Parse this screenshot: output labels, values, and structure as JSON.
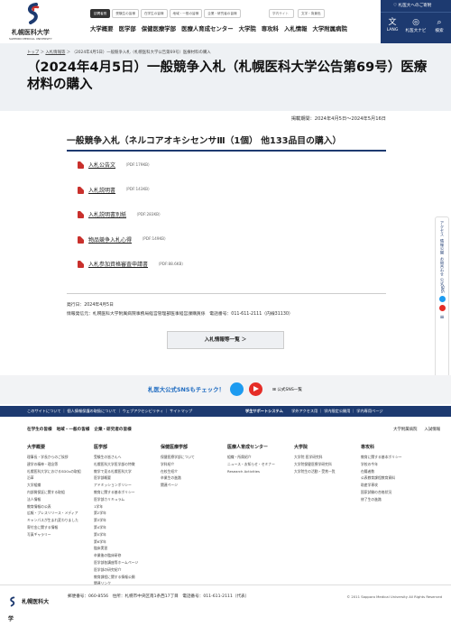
{
  "header": {
    "logo_text": "札幌医科大学",
    "logo_subtext": "SAPPORO MEDICAL UNIVERSITY",
    "top_links": [
      "訪問者別",
      "受験生の皆様",
      "在学生の皆様",
      "地域・一般の皆様",
      "企業・研究者の皆様"
    ],
    "search_label": "学内サイト",
    "language_label": "文字・背景色",
    "main_nav": [
      "大学概要",
      "医学部",
      "保健医療学部",
      "医療人育成センター",
      "大学院",
      "専攻科",
      "入札情報",
      "大学附属病院"
    ],
    "right_top": "札医大へのご寄附",
    "right_buttons": [
      {
        "label": "LANG",
        "icon": "translate-icon"
      },
      {
        "label": "札医大ナビ",
        "icon": "compass-icon"
      },
      {
        "label": "検索",
        "icon": "search-icon"
      }
    ]
  },
  "breadcrumb": {
    "home": "トップ",
    "section": "入札情報等",
    "current": "（2024年4月5日）一般競争入札（札幌医科大学公告第69号）医療材料の購入"
  },
  "page_title": "（2024年4月5日）一般競争入札（札幌医科大学公告第69号）医療材料の購入",
  "period": "掲載期間：2024年4月5日～2024年5月16日",
  "section_heading": "一般競争入札（ネルコアオキシセンサⅢ（1個） 他133品目の購入）",
  "files": [
    {
      "label": "入札公告文",
      "size": "（PDF:179KB）"
    },
    {
      "label": "入札説明書",
      "size": "（PDF:143KB）"
    },
    {
      "label": "入札説明書別紙",
      "size": "（PDF:283KB）"
    },
    {
      "label": "物品競争入札心得",
      "size": "（PDF:149KB）"
    },
    {
      "label": "入札参加資格審査申請書",
      "size": "（PDF:88.6KB）"
    }
  ],
  "meta": {
    "date": "発行日：2024年4月5日",
    "sender": "情報発信元：札幌医科大学附属病院事務局経営管理部医事経営課購買係　電話番号：011-611-2111（内線31130）"
  },
  "list_button": "入札情報等一覧",
  "side_tabs": [
    "アクセス",
    "情報公開",
    "お問合わせ",
    "公式SNS"
  ],
  "sns": {
    "title": "札医大公式SNSもチェック！",
    "all_link": "公式SNS一覧"
  },
  "footer_bar": {
    "left": "このサイトについて ｜ 個人情報保護の取扱について ｜ ウェブアクセシビリティ ｜ サイトマップ",
    "right": [
      "学生サポートシステム",
      "学外アクセス用",
      "学内限定公開用",
      "学内専用ページ"
    ]
  },
  "footer_cats": [
    "在学生の皆様",
    "地域・一般の皆様",
    "企業・研究者の皆様"
  ],
  "footer_cats_right": [
    "大学附属病院",
    "入試情報"
  ],
  "footer_columns": [
    {
      "heading": "大学概要",
      "items": [
        "理事長・学長からのご挨拶",
        "建学の精神・理念等",
        "札幌医科大学におけるSDGsの取組",
        "沿革",
        "大学組織",
        "内部質保証に関する取組",
        "法人情報",
        "教育情報の公表",
        "広報・プレスリリース・メディア",
        "キャンパスが生まれ変わりました",
        "寄付金に関する情報",
        "写真ギャラリー"
      ]
    },
    {
      "heading": "医学部",
      "items": [
        "受験生の皆さんへ",
        "札幌医科大学医学部の特徴",
        "教学で見る札幌医科大学",
        "医学部概要",
        "アドミッションポリシー",
        "教育に関する基本ポリシー",
        "医学部カリキュラム",
        "1学年",
        "第2学年",
        "第3学年",
        "第4学年",
        "第5学年",
        "第6学年",
        "臨床実習",
        "卒業後の臨床研修",
        "医学部各講座等ホームページ",
        "医学部の研究紹介",
        "教育課程に関する情報公開",
        "関連リンク"
      ]
    },
    {
      "heading": "保健医療学部",
      "items": [
        "保健医療学部について",
        "学科紹介",
        "在校生紹介",
        "卒業生の進路",
        "関連ページ"
      ]
    },
    {
      "heading": "医療人育成センター",
      "items": [
        "組織・所属紹介",
        "ニュース・お知らせ・セミナー",
        "Research Activities"
      ]
    },
    {
      "heading": "大学院",
      "items": [
        "大学院 医学研究科",
        "大学院保健医療学研究科",
        "大学院生の活動・受賞一覧"
      ]
    },
    {
      "heading": "専攻科",
      "items": [
        "教育に関する基本ポリシー",
        "学校の今年",
        "在籍者数",
        "公表教育課程教育資料",
        "助産学専攻",
        "国家試験の合格状況",
        "修了生の進路"
      ]
    }
  ],
  "footer_bottom": {
    "logo": "札幌医科大学",
    "address": "郵便番号：060-8556　住所：札幌市中央区南1条西17丁目　電話番号：011-611-2111（代表）",
    "copyright": "© 2011 Sapporo Medical University All Rights Reserved"
  },
  "colors": {
    "navy": "#1d3a70",
    "pdf_red": "#c9302c",
    "sns_blue": "#1d6ac0"
  }
}
